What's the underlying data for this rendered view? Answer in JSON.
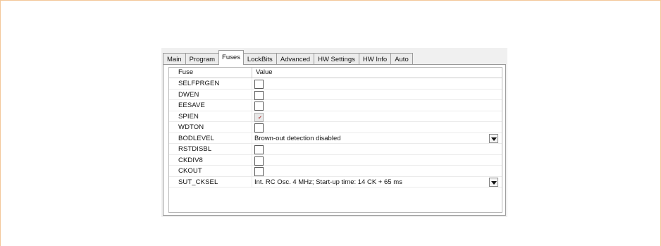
{
  "tabs": [
    {
      "label": "Main",
      "active": false
    },
    {
      "label": "Program",
      "active": false
    },
    {
      "label": "Fuses",
      "active": true
    },
    {
      "label": "LockBits",
      "active": false
    },
    {
      "label": "Advanced",
      "active": false
    },
    {
      "label": "HW Settings",
      "active": false
    },
    {
      "label": "HW Info",
      "active": false
    },
    {
      "label": "Auto",
      "active": false
    }
  ],
  "grid": {
    "header_fuse": "Fuse",
    "header_value": "Value",
    "rows": [
      {
        "name": "SELFPRGEN",
        "type": "checkbox",
        "checked": false,
        "disabled": false
      },
      {
        "name": "DWEN",
        "type": "checkbox",
        "checked": false,
        "disabled": false
      },
      {
        "name": "EESAVE",
        "type": "checkbox",
        "checked": false,
        "disabled": false
      },
      {
        "name": "SPIEN",
        "type": "checkbox",
        "checked": true,
        "disabled": true
      },
      {
        "name": "WDTON",
        "type": "checkbox",
        "checked": false,
        "disabled": false
      },
      {
        "name": "BODLEVEL",
        "type": "dropdown",
        "value": "Brown-out detection disabled"
      },
      {
        "name": "RSTDISBL",
        "type": "checkbox",
        "checked": false,
        "disabled": false
      },
      {
        "name": "CKDIV8",
        "type": "checkbox",
        "checked": false,
        "disabled": false
      },
      {
        "name": "CKOUT",
        "type": "checkbox",
        "checked": false,
        "disabled": false
      },
      {
        "name": "SUT_CKSEL",
        "type": "dropdown",
        "value": "Int. RC Osc. 4 MHz; Start-up time: 14 CK + 65 ms"
      }
    ]
  }
}
